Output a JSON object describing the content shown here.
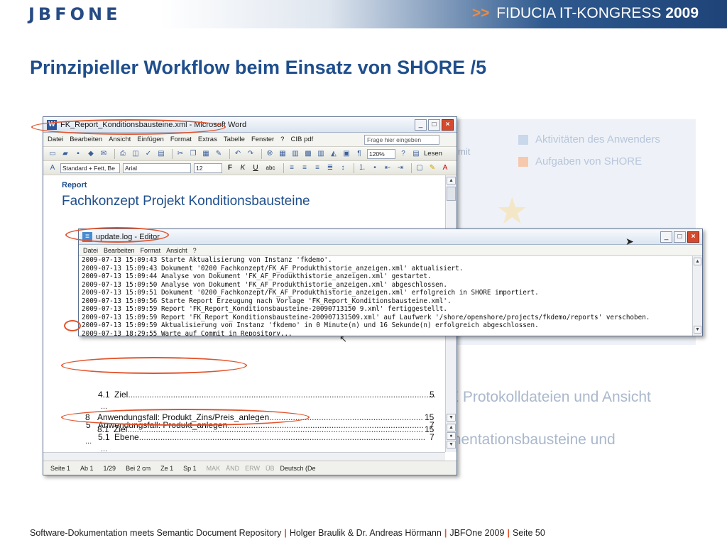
{
  "header": {
    "logo": "JBFONE",
    "congress_prefix": ">>",
    "congress_name": "FIDUCIA IT-KONGRESS",
    "congress_year": "2009"
  },
  "slide": {
    "title": "Prinzipieller Workflow beim Einsatz von SHORE  /5"
  },
  "background": {
    "legend": [
      {
        "label": "Aktivitäten des Anwenders",
        "color": "#c9d8ea"
      },
      {
        "label": "Aufgaben von SHORE",
        "color": "#f6c9ad"
      }
    ],
    "mit_text": "mit",
    "text_1": "E Protokolldateien und Ansicht",
    "text_2": "mentationsbausteine und"
  },
  "word_window": {
    "title": "FK_Report_Konditionsbausteine.xml - Microsoft Word",
    "menu": [
      "Datei",
      "Bearbeiten",
      "Ansicht",
      "Einfügen",
      "Format",
      "Extras",
      "Tabelle",
      "Fenster",
      "?",
      "CIB pdf"
    ],
    "help_placeholder": "Frage hier eingeben",
    "zoom": "120%",
    "read_label": "Lesen",
    "style_value": "Standard + Fett, Be",
    "font_value": "Arial",
    "size_value": "12",
    "format_buttons": [
      "F",
      "K",
      "U",
      "abc"
    ],
    "doc": {
      "report_label": "Report",
      "heading": "Fachkonzept Projekt Konditionsbausteine",
      "toc": [
        {
          "num": "4.1",
          "text": "Ziel",
          "page": "5"
        },
        {
          "num": "5",
          "text": "Anwendungsfall: Produkt_anlegen",
          "page": "7"
        },
        {
          "num": "5.1",
          "text": "Ebene",
          "page": "7"
        },
        {
          "num": "8",
          "text": "Anwendungsfall: Produkt_Zins/Preis_anlegen",
          "page": "15"
        },
        {
          "num": "8.1",
          "text": "Ziel",
          "page": "15"
        }
      ],
      "ellipsis": "..."
    },
    "status": {
      "page": "Seite  1",
      "section": "Ab  1",
      "pages": "1/29",
      "position": "Bei  2 cm",
      "line": "Ze  1",
      "col": "Sp  1",
      "modes": [
        "MAK",
        "ÄND",
        "ERW",
        "ÜB"
      ],
      "language": "Deutsch (De"
    }
  },
  "editor_window": {
    "title": "update.log - Editor",
    "menu": [
      "Datei",
      "Bearbeiten",
      "Format",
      "Ansicht",
      "?"
    ],
    "log_lines": [
      "2009-07-13 15:09:43 Starte Aktualisierung von Instanz 'fkdemo'.",
      "2009-07-13 15:09:43 Dokument '0200_Fachkonzept/FK_AF_Produkthistorie_anzeigen.xml' aktualisiert.",
      "2009-07-13 15:09:44 Analyse von Dokument 'FK_AF_Produkthistorie_anzeigen.xml' gestartet.",
      "2009-07-13 15:09:50 Analyse von Dokument 'FK_AF_Produkthistorie_anzeigen.xml' abgeschlossen.",
      "2009-07-13 15:09:51 Dokument '0200_Fachkonzept/FK_AF_Produkthistorie_anzeigen.xml' erfolgreich in SHORE importiert.",
      "2009-07-13 15:09:56 Starte Report Erzeugung nach Vorlage 'FK_Report_Konditionsbausteine.xml'.",
      "2009-07-13 15:09:59 Report 'FK_Report_Konditionsbausteine-20090713150 9.xml' fertiggestellt.",
      "2009-07-13 15:09:59 Report 'FK_Report_Konditionsbausteine-200907131509.xml' auf Laufwerk '/shore/openshore/projects/fkdemo/reports' verschoben.",
      "2009-07-13 15:09:59 Aktualisierung von Instanz 'fkdemo' in 0 Minute(n) und 16 Sekunde(n) erfolgreich abgeschlossen.",
      "2009-07-13 18:29:55 Warte auf Commit in Repository..."
    ]
  },
  "footer": {
    "part1": "Software-Dokumentation meets Semantic Document Repository",
    "part2": "Holger Braulik & Dr. Andreas Hörmann",
    "part3": "JBFOne 2009",
    "part4": "Seite 50",
    "separator": "|"
  },
  "colors": {
    "brand_blue": "#1f4e8c",
    "accent_orange": "#e2542c"
  }
}
